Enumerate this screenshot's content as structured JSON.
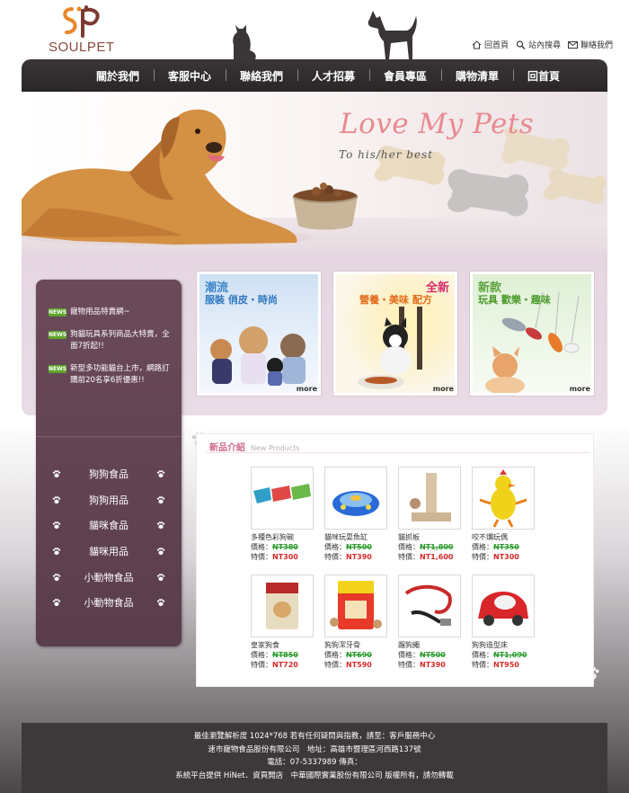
{
  "brand": {
    "name": "SOULPET"
  },
  "top_links": [
    {
      "label": "回首頁",
      "icon": "home-icon"
    },
    {
      "label": "站內搜尋",
      "icon": "search-icon"
    },
    {
      "label": "聯絡我們",
      "icon": "mail-icon"
    }
  ],
  "nav": [
    "關於我們",
    "客服中心",
    "聯絡我們",
    "人才招募",
    "會員專區",
    "購物清單",
    "回首頁"
  ],
  "hero": {
    "title": "Love My Pets",
    "subtitle": "To his/her best"
  },
  "news": [
    {
      "badge": "NEWS",
      "text": "寵物用品特賣網~"
    },
    {
      "badge": "NEWS",
      "text": "狗貓玩具系列商品大特賣，全面7折起!!"
    },
    {
      "badge": "NEWS",
      "text": "新型多功能貓台上市，網路訂購前20名享6折優惠!!"
    }
  ],
  "categories": [
    "狗狗食品",
    "狗狗用品",
    "貓咪食品",
    "貓咪用品",
    "小動物食品",
    "小動物食品"
  ],
  "promos": [
    {
      "title_a": "潮流",
      "title_b": "服裝 俏皮・時尚",
      "more": "more"
    },
    {
      "title_a": "全新",
      "title_b": "營養・美味 配方",
      "more": "more"
    },
    {
      "title_a": "新款",
      "title_b": "玩具 歡樂・趣味",
      "more": "more"
    }
  ],
  "new_products": {
    "title": "新品介紹",
    "subtitle": "New Products",
    "price_label": "價格：",
    "special_label": "特價：",
    "items": [
      {
        "name": "多種色彩狗碗",
        "price": "NT380",
        "special": "NT300"
      },
      {
        "name": "貓咪玩耍魚缸",
        "price": "NT500",
        "special": "NT390"
      },
      {
        "name": "貓抓板",
        "price": "NT1,800",
        "special": "NT1,600"
      },
      {
        "name": "咬不爛玩偶",
        "price": "NT350",
        "special": "NT300"
      },
      {
        "name": "皇家狗食",
        "price": "NT850",
        "special": "NT720"
      },
      {
        "name": "狗狗潔牙骨",
        "price": "NT690",
        "special": "NT590"
      },
      {
        "name": "蹓狗繩",
        "price": "NT500",
        "special": "NT390"
      },
      {
        "name": "狗狗造型床",
        "price": "NT1,090",
        "special": "NT950"
      }
    ]
  },
  "footer": {
    "lines": [
      "最佳瀏覽解析度 1024*768 若有任何疑問與指教，請至：客戶服務中心",
      "速市寵物食品股份有限公司　地址：高雄市暨理區河西路137號",
      "電話：07-5337989 傳真：",
      "系統平台提供 HiNet．資頁開店　中華國際實業股份有限公司 版權所有，請勿轉載"
    ]
  }
}
